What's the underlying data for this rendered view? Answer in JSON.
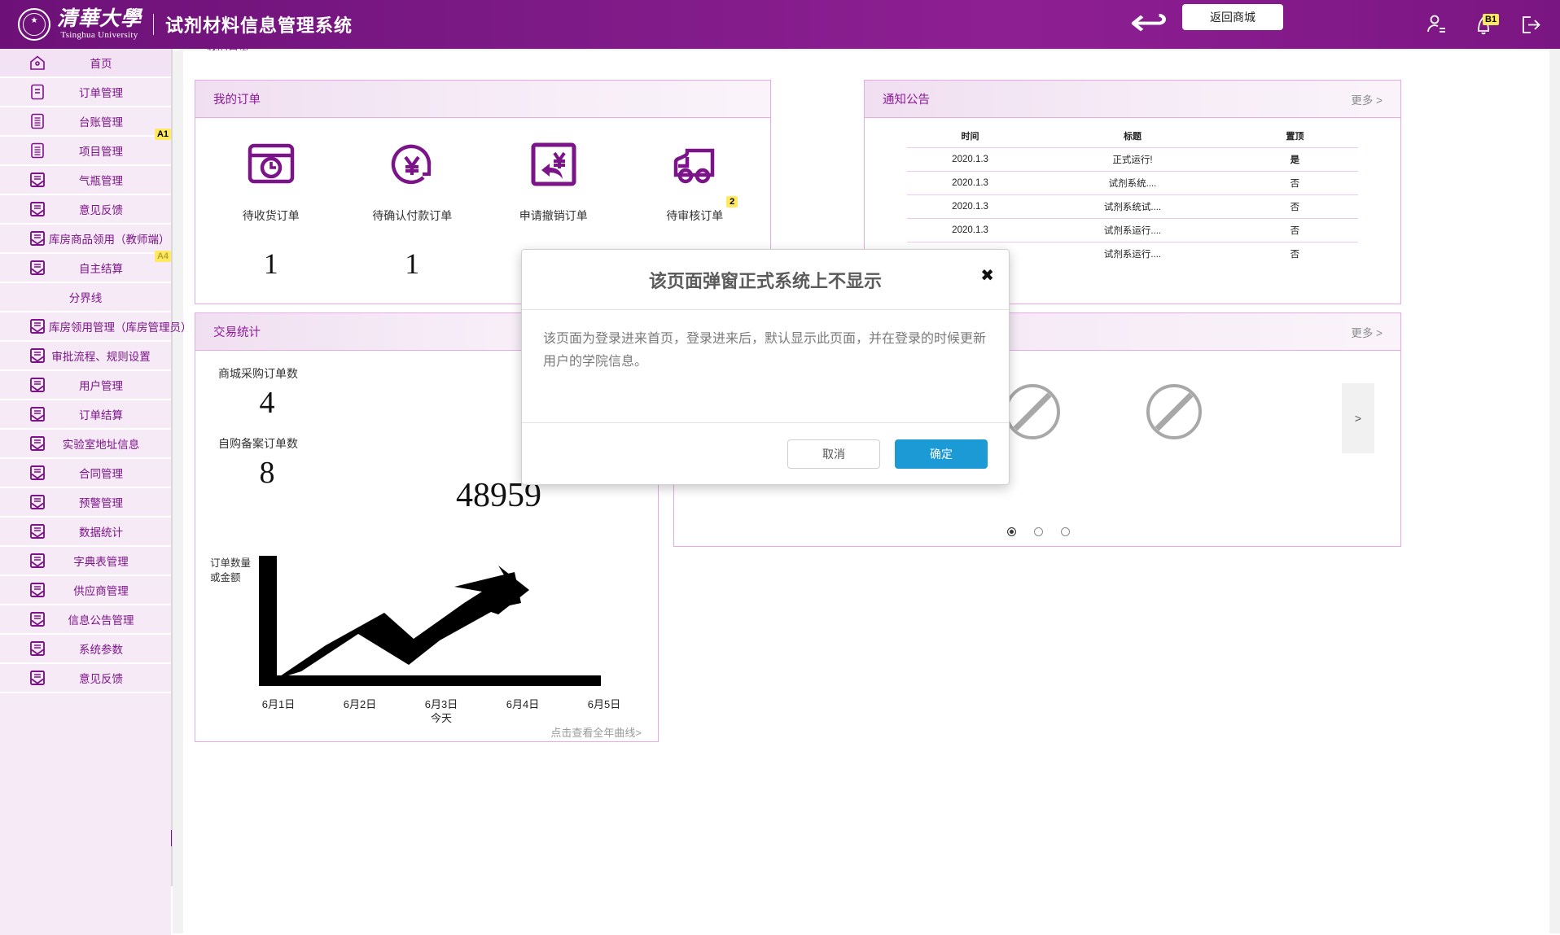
{
  "header": {
    "university_cn": "清華大學",
    "university_en": "Tsinghua University",
    "system_title": "试剂材料信息管理系统",
    "back_to_mall": "返回商城",
    "notification_badge": "B1",
    "icons": {
      "user": "user-icon",
      "bell": "bell-icon",
      "logout": "logout-icon",
      "back_arrow": "back-arrow-icon"
    },
    "colors": {
      "brand_purple": "#7b1488",
      "badge_yellow": "#ffe95e"
    }
  },
  "sidebar": {
    "items": [
      {
        "label": "首页",
        "icon": "home-icon",
        "active": true,
        "badge": ""
      },
      {
        "label": "订单管理",
        "icon": "clipboard-icon",
        "active": false,
        "badge": ""
      },
      {
        "label": "台账管理",
        "icon": "clipboard-lines-icon",
        "active": false,
        "badge": ""
      },
      {
        "label": "项目管理",
        "icon": "clipboard-lines-icon",
        "active": false,
        "badge": "A1"
      },
      {
        "label": "气瓶管理",
        "icon": "envelope-icon",
        "active": false,
        "badge": ""
      },
      {
        "label": "意见反馈",
        "icon": "envelope-icon",
        "active": false,
        "badge": ""
      },
      {
        "label": "库房商品领用（教师端）",
        "icon": "envelope-icon",
        "active": false,
        "badge": ""
      },
      {
        "label": "自主结算",
        "icon": "envelope-icon",
        "active": false,
        "badge": "A4"
      },
      {
        "label": "分界线",
        "icon": "",
        "active": false,
        "badge": ""
      },
      {
        "label": "库房领用管理（库房管理员）",
        "icon": "envelope-icon",
        "active": false,
        "badge": ""
      },
      {
        "label": "审批流程、规则设置",
        "icon": "envelope-icon",
        "active": false,
        "badge": ""
      },
      {
        "label": "用户管理",
        "icon": "envelope-icon",
        "active": false,
        "badge": ""
      },
      {
        "label": "订单结算",
        "icon": "envelope-icon",
        "active": false,
        "badge": ""
      },
      {
        "label": "实验室地址信息",
        "icon": "envelope-icon",
        "active": false,
        "badge": ""
      },
      {
        "label": "合同管理",
        "icon": "envelope-icon",
        "active": false,
        "badge": ""
      },
      {
        "label": "预警管理",
        "icon": "envelope-icon",
        "active": false,
        "badge": ""
      },
      {
        "label": "数据统计",
        "icon": "envelope-icon",
        "active": false,
        "badge": ""
      },
      {
        "label": "字典表管理",
        "icon": "envelope-icon",
        "active": false,
        "badge": ""
      },
      {
        "label": "供应商管理",
        "icon": "envelope-icon",
        "active": false,
        "badge": ""
      },
      {
        "label": "信息公告管理",
        "icon": "envelope-icon",
        "active": false,
        "badge": ""
      },
      {
        "label": "系统参数",
        "icon": "envelope-icon",
        "active": false,
        "badge": ""
      },
      {
        "label": "意见反馈",
        "icon": "envelope-icon",
        "active": false,
        "badge": ""
      }
    ]
  },
  "tab": {
    "label": "我的首页"
  },
  "my_orders": {
    "title": "我的订单",
    "tiles": [
      {
        "label": "待收货订单",
        "count": "1",
        "icon": "box-clock-icon",
        "badge": ""
      },
      {
        "label": "待确认付款订单",
        "count": "1",
        "icon": "yen-circle-icon",
        "badge": ""
      },
      {
        "label": "申请撤销订单",
        "count": "",
        "icon": "yen-return-icon",
        "badge": ""
      },
      {
        "label": "待审核订单",
        "count": "",
        "icon": "truck-icon",
        "badge": "2"
      }
    ]
  },
  "notice": {
    "title": "通知公告",
    "more": "更多 >",
    "columns": [
      "时间",
      "标题",
      "置顶"
    ],
    "rows": [
      [
        "2020.1.3",
        "正式运行!",
        "是"
      ],
      [
        "2020.1.3",
        "试剂系统....",
        "否"
      ],
      [
        "2020.1.3",
        "试剂系统试....",
        "否"
      ],
      [
        "2020.1.3",
        "试剂系运行....",
        "否"
      ],
      [
        "",
        "试剂系运行....",
        "否"
      ]
    ]
  },
  "stats": {
    "title": "交易统计",
    "mall_order_label": "商城采购订单数",
    "mall_order_value": "4",
    "self_order_label": "自购备案订单数",
    "self_order_value": "8",
    "amount_value": "48959",
    "chart_more": "点击查看全年曲线>"
  },
  "carousel": {
    "more": "更多 >",
    "next": ">",
    "dots": [
      true,
      false,
      false
    ]
  },
  "modal": {
    "title": "该页面弹窗正式系统上不显示",
    "body": "该页面为登录进来首页，登录进来后，默认显示此页面，并在登录的时候更新用户的学院信息。",
    "cancel": "取消",
    "ok": "确定",
    "close": "✖"
  },
  "chart_data": {
    "type": "line",
    "title": "交易统计",
    "ylabel": "订单数量\n或金额",
    "ylabel_line1": "订单数量",
    "ylabel_line2": "或金额",
    "categories": [
      "6月1日",
      "6月2日",
      "6月3日",
      "6月4日",
      "6月5日"
    ],
    "sub_labels": [
      "",
      "",
      "今天",
      "",
      ""
    ],
    "values": [
      18,
      52,
      30,
      70,
      96
    ],
    "ylim": [
      0,
      100
    ],
    "xlabel": "",
    "grid": false,
    "legend": "none",
    "annotation": "点击查看全年曲线>"
  }
}
